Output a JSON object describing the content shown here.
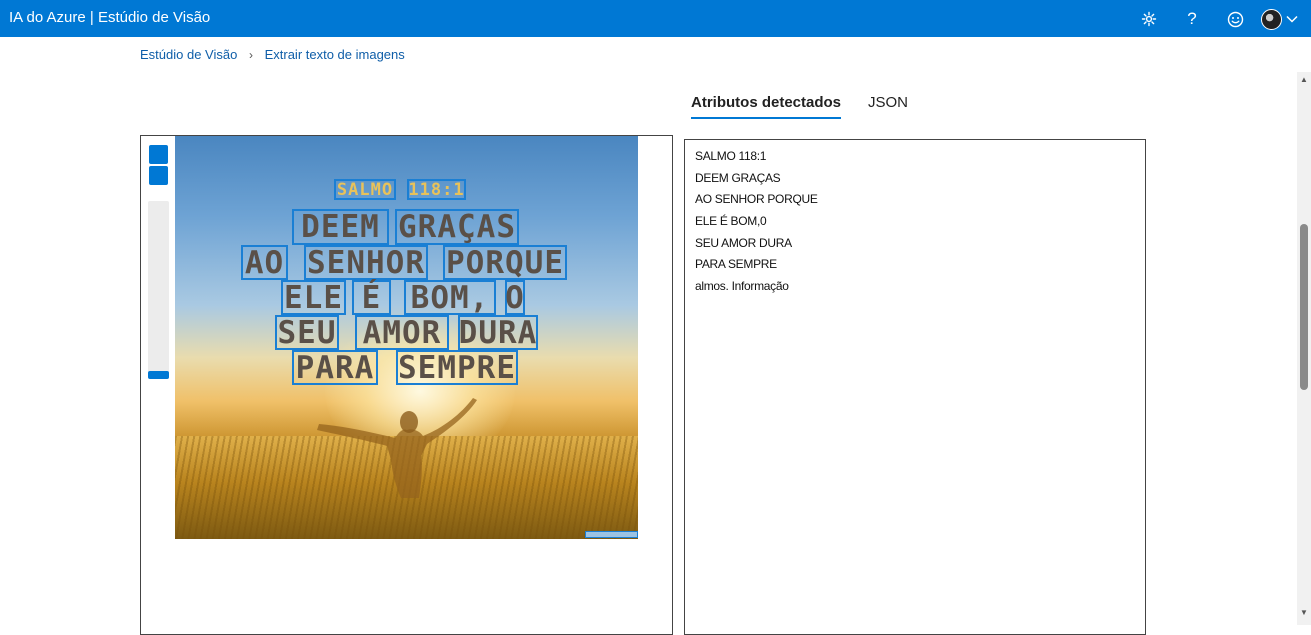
{
  "app": {
    "title": "IA do Azure | Estúdio de Visão",
    "icons": [
      "settings-icon",
      "help-icon",
      "feedback-smiley-icon",
      "user-avatar",
      "chevron-down-icon"
    ]
  },
  "breadcrumb": {
    "root": "Estúdio de Visão",
    "separator": "›",
    "current": "Extrair texto de imagens"
  },
  "tabs": [
    {
      "label": "Atributos detectados",
      "active": true
    },
    {
      "label": "JSON",
      "active": false
    }
  ],
  "image": {
    "ocr_lines": [
      {
        "words": [
          "SALMO",
          "118:1"
        ]
      },
      {
        "words": [
          "DEEM",
          "GRAÇAS"
        ]
      },
      {
        "words": [
          "AO",
          "SENHOR",
          "PORQUE"
        ]
      },
      {
        "words": [
          "ELE",
          "É",
          "BOM,",
          "O"
        ]
      },
      {
        "words": [
          "SEU",
          "AMOR",
          "DURA"
        ]
      },
      {
        "words": [
          "PARA",
          "SEMPRE"
        ]
      }
    ],
    "zoom": {
      "level": 0.0
    }
  },
  "results": {
    "lines": [
      "SALMO 118:1",
      "DEEM GRAÇAS",
      "AO SENHOR PORQUE",
      "ELE É BOM,0",
      "SEU AMOR DURA",
      "PARA SEMPRE",
      "almos. Informação"
    ]
  },
  "colors": {
    "topbar": "#0078d4",
    "accent": "#0078d4",
    "link": "#0f5ea8",
    "ocr_box": "#1a7fd4"
  }
}
